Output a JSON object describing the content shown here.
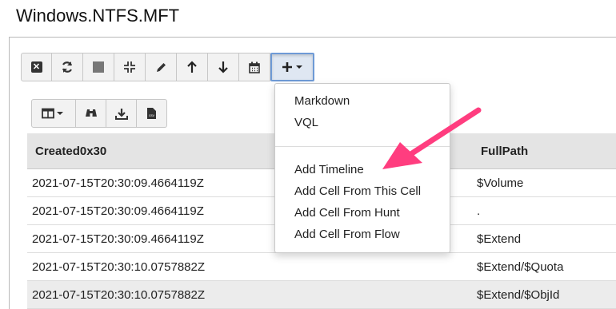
{
  "page_title": "Windows.NTFS.MFT",
  "toolbar": {
    "buttons": [
      {
        "icon": "close-icon",
        "glyph": "✖"
      },
      {
        "icon": "refresh-icon",
        "glyph": "⟳"
      },
      {
        "icon": "stop-icon",
        "glyph": "■"
      },
      {
        "icon": "compress-icon",
        "glyph": "⁂"
      },
      {
        "icon": "pencil-icon",
        "glyph": "✎"
      },
      {
        "icon": "arrow-up-icon",
        "glyph": "↑"
      },
      {
        "icon": "arrow-down-icon",
        "glyph": "↓"
      },
      {
        "icon": "calendar-icon",
        "glyph": "▦"
      },
      {
        "icon": "add-cell-dropdown-icon",
        "glyph": "+▾"
      }
    ]
  },
  "subtoolbar": {
    "buttons": [
      {
        "icon": "columns-dropdown-icon",
        "glyph": "◫▾"
      },
      {
        "icon": "binoculars-icon",
        "glyph": "⚯"
      },
      {
        "icon": "download-icon",
        "glyph": "⤓"
      },
      {
        "icon": "csv-file-icon",
        "glyph": "csv"
      }
    ]
  },
  "table": {
    "columns": [
      "Created0x30",
      "FullPath"
    ],
    "rows": [
      {
        "created": "2021-07-15T20:30:09.4664119Z",
        "path": "$Volume"
      },
      {
        "created": "2021-07-15T20:30:09.4664119Z",
        "path": "."
      },
      {
        "created": "2021-07-15T20:30:09.4664119Z",
        "path": "$Extend"
      },
      {
        "created": "2021-07-15T20:30:10.0757882Z",
        "path": "$Extend/$Quota"
      },
      {
        "created": "2021-07-15T20:30:10.0757882Z",
        "path": "$Extend/$ObjId"
      }
    ]
  },
  "dropdown_menu": {
    "items": [
      "Markdown",
      "VQL",
      "Add Timeline",
      "Add Cell From This Cell",
      "Add Cell From Hunt",
      "Add Cell From Flow"
    ]
  },
  "colors": {
    "annotation_arrow": "#ff3d7f",
    "active_button_border": "#6e9ad6"
  }
}
